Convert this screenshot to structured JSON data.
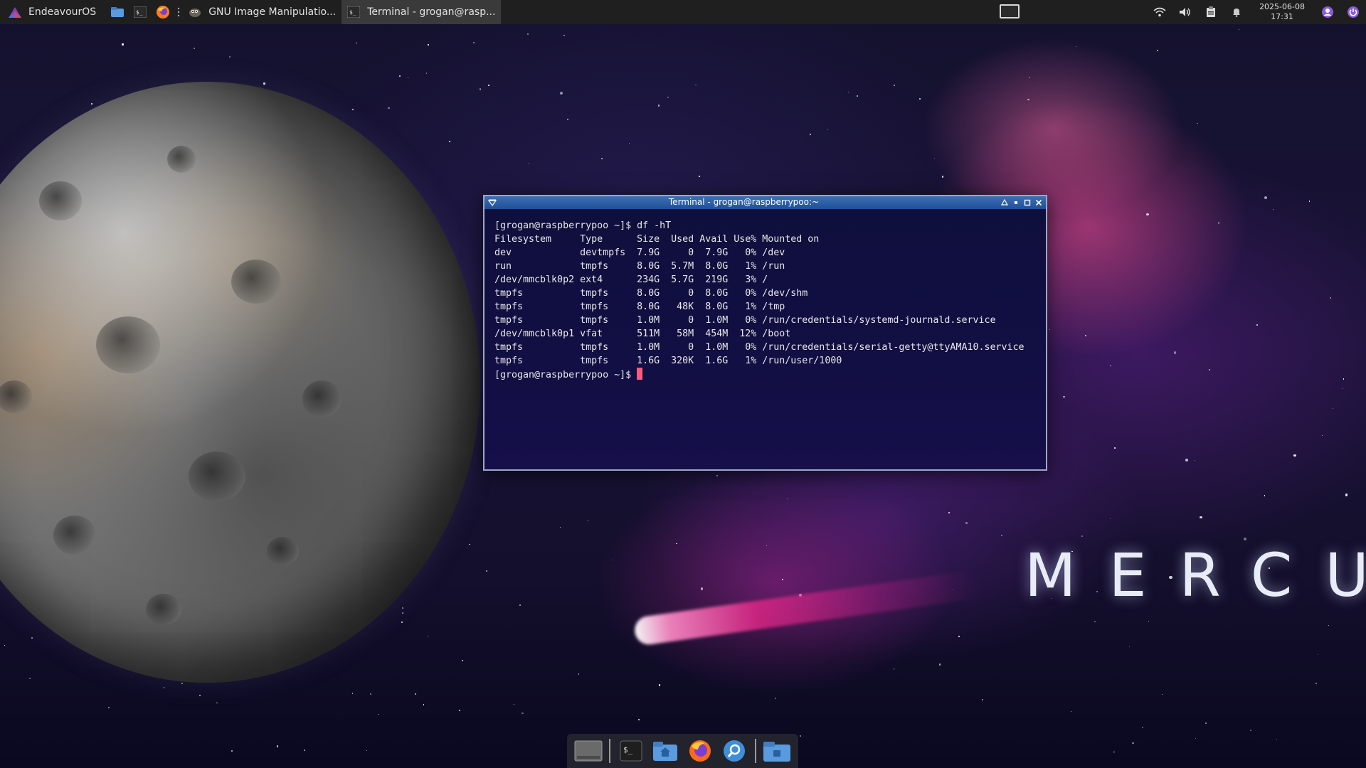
{
  "top_panel": {
    "app_menu_label": "EndeavourOS",
    "tasks": [
      {
        "label": "GNU Image Manipulatio...",
        "active": false
      },
      {
        "label": "Terminal - grogan@rasp...",
        "active": true
      }
    ],
    "clock": {
      "date": "2025-06-08",
      "time": "17:31"
    }
  },
  "terminal": {
    "title": "Terminal - grogan@raspberrypoo:~",
    "lines": [
      "[grogan@raspberrypoo ~]$ df -hT",
      "Filesystem     Type      Size  Used Avail Use% Mounted on",
      "dev            devtmpfs  7.9G     0  7.9G   0% /dev",
      "run            tmpfs     8.0G  5.7M  8.0G   1% /run",
      "/dev/mmcblk0p2 ext4      234G  5.7G  219G   3% /",
      "tmpfs          tmpfs     8.0G     0  8.0G   0% /dev/shm",
      "tmpfs          tmpfs     8.0G   48K  8.0G   1% /tmp",
      "tmpfs          tmpfs     1.0M     0  1.0M   0% /run/credentials/systemd-journald.service",
      "/dev/mmcblk0p1 vfat      511M   58M  454M  12% /boot",
      "tmpfs          tmpfs     1.0M     0  1.0M   0% /run/credentials/serial-getty@ttyAMA10.service",
      "tmpfs          tmpfs     1.6G  320K  1.6G   1% /run/user/1000"
    ],
    "prompt": "[grogan@raspberrypoo ~]$ "
  },
  "wallpaper": {
    "caption": "MERCURY"
  },
  "colors": {
    "panel_bg": "#1f1f1f",
    "titlebar": "#2b5fa8",
    "terminal_bg": "#0f0f3d",
    "cursor": "#ff5a7a"
  }
}
